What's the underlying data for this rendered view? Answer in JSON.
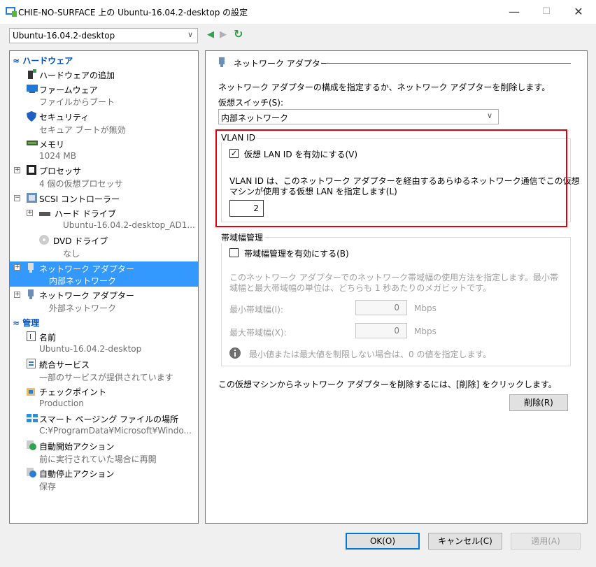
{
  "window": {
    "title": "CHIE-NO-SURFACE 上の Ubuntu-16.04.2-desktop の設定",
    "minimize": "—",
    "maximize": "☐",
    "close": "✕"
  },
  "vm_selector": {
    "value": "Ubuntu-16.04.2-desktop"
  },
  "tree": {
    "hardware_section": "ハードウェア",
    "add_hardware": "ハードウェアの追加",
    "firmware": "ファームウェア",
    "firmware_sub": "ファイルからブート",
    "security": "セキュリティ",
    "security_sub": "セキュア ブートが無効",
    "memory": "メモリ",
    "memory_sub": "1024 MB",
    "processor": "プロセッサ",
    "processor_sub": "4 個の仮想プロセッサ",
    "scsi": "SCSI コントローラー",
    "hdd": "ハード ドライブ",
    "hdd_sub": "Ubuntu-16.04.2-desktop_AD1...",
    "dvd": "DVD ドライブ",
    "dvd_sub": "なし",
    "nic1": "ネットワーク アダプター",
    "nic1_sub": "内部ネットワーク",
    "nic2": "ネットワーク アダプター",
    "nic2_sub": "外部ネットワーク",
    "management_section": "管理",
    "name": "名前",
    "name_sub": "Ubuntu-16.04.2-desktop",
    "integration": "統合サービス",
    "integration_sub": "一部のサービスが提供されています",
    "checkpoint": "チェックポイント",
    "checkpoint_sub": "Production",
    "paging": "スマート ページング ファイルの場所",
    "paging_sub": "C:¥ProgramData¥Microsoft¥Windo...",
    "autostart": "自動開始アクション",
    "autostart_sub": "前に実行されていた場合に再開",
    "autostop": "自動停止アクション",
    "autostop_sub": "保存"
  },
  "nav": {
    "back": "◀",
    "forward": "▶",
    "refresh": "↻"
  },
  "panel": {
    "heading": "ネットワーク アダプター",
    "description": "ネットワーク アダプターの構成を指定するか、ネットワーク アダプターを削除します。",
    "switch_label": "仮想スイッチ(S):",
    "switch_value": "内部ネットワーク",
    "vlan_group": "VLAN ID",
    "vlan_checkbox": "仮想 LAN ID を有効にする(V)",
    "vlan_checked": true,
    "vlan_desc_1": "VLAN ID は、このネットワーク アダプターを経由するあらゆるネットワーク通信でこの仮想",
    "vlan_desc_2": "マシンが使用する仮想 LAN を指定します(L)",
    "vlan_value": "2",
    "bw_group": "帯域幅管理",
    "bw_checkbox": "帯域幅管理を有効にする(B)",
    "bw_checked": false,
    "bw_desc_1": "このネットワーク アダプターでのネットワーク帯域幅の使用方法を指定します。最小帯",
    "bw_desc_2": "域幅と最大帯域幅の単位は、どちらも 1 秒あたりのメガビットです。",
    "bw_min_label": "最小帯域幅(I):",
    "bw_min_value": "0",
    "bw_min_unit": "Mbps",
    "bw_max_label": "最大帯域幅(X):",
    "bw_max_value": "0",
    "bw_max_unit": "Mbps",
    "bw_info": "最小値または最大値を制限しない場合は、0 の値を指定します。",
    "remove_desc": "この仮想マシンからネットワーク アダプターを削除するには、[削除] をクリックします。",
    "remove_button": "削除(R)"
  },
  "footer": {
    "ok": "OK(O)",
    "cancel": "キャンセル(C)",
    "apply": "適用(A)"
  },
  "colors": {
    "selection": "#3399ff",
    "highlight_box": "#e0000f",
    "section": "#0050c0"
  }
}
